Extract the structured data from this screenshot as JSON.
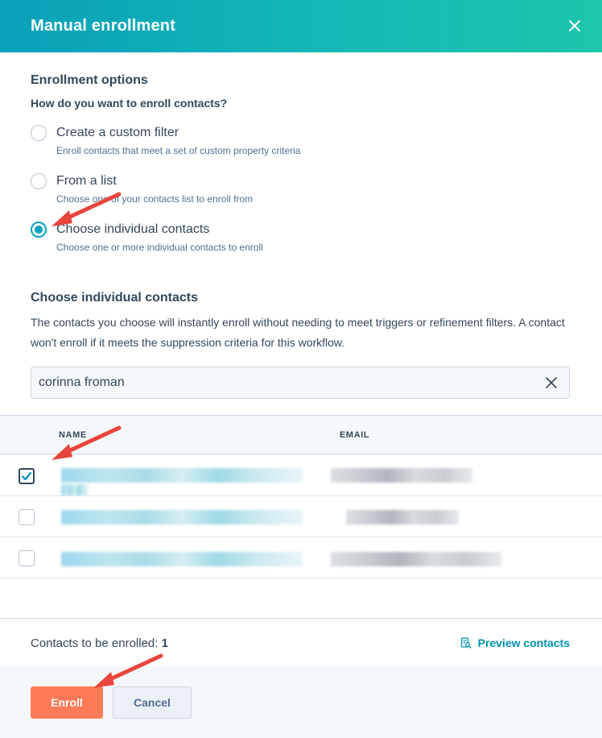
{
  "header": {
    "title": "Manual enrollment",
    "accent_color": "#00a4bd",
    "close_icon": "close-icon"
  },
  "enrollment_options": {
    "heading": "Enrollment options",
    "question": "How do you want to enroll contacts?",
    "options": [
      {
        "label": "Create a custom filter",
        "description": "Enroll contacts that meet a set of custom property criteria",
        "selected": false
      },
      {
        "label": "From a list",
        "description": "Choose one of your contacts list to enroll from",
        "selected": false
      },
      {
        "label": "Choose individual contacts",
        "description": "Choose one or more individual contacts to enroll",
        "selected": true
      }
    ]
  },
  "individual_contacts": {
    "heading": "Choose individual contacts",
    "description": "The contacts you choose will instantly enroll without needing to meet triggers or refinement filters. A contact won't enroll if it meets the suppression criteria for this workflow.",
    "search": {
      "value": "corinna froman",
      "clear_icon": "close-icon"
    }
  },
  "table": {
    "columns": [
      "NAME",
      "EMAIL"
    ],
    "rows": [
      {
        "checked": true
      },
      {
        "checked": false
      },
      {
        "checked": false
      }
    ]
  },
  "footer": {
    "count_label": "Contacts to be enrolled:",
    "count_value": "1",
    "preview_label": "Preview contacts",
    "preview_icon": "preview-document-icon"
  },
  "actions": {
    "primary_label": "Enroll",
    "secondary_label": "Cancel",
    "primary_color": "#ff7a59"
  },
  "annotation_color": "#e8453c"
}
